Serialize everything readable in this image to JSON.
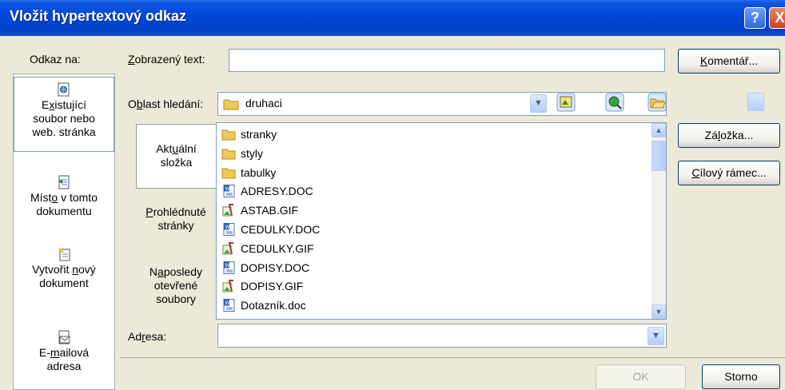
{
  "window": {
    "title": "Vložit hypertextový odkaz",
    "help_label": "?",
    "close_label": "X"
  },
  "link_to": {
    "label": "Odkaz na:",
    "items": [
      {
        "line1_pre": "E",
        "line1_key": "x",
        "line1_post": "istující",
        "line2": "soubor nebo",
        "line3": "web. stránka",
        "icon": "existing-file-icon",
        "selected": true
      },
      {
        "line1_pre": "Míst",
        "line1_key": "o",
        "line1_post": " v tomto",
        "line2": "dokumentu",
        "line3": "",
        "icon": "place-in-document-icon",
        "selected": false
      },
      {
        "line1_pre": "Vytvořit ",
        "line1_key": "n",
        "line1_post": "ový",
        "line2": "dokument",
        "line3": "",
        "icon": "new-document-icon",
        "selected": false
      },
      {
        "line1_pre": "E-",
        "line1_key": "m",
        "line1_post": "ailová",
        "line2": "adresa",
        "line3": "",
        "icon": "email-address-icon",
        "selected": false
      }
    ]
  },
  "display_text": {
    "label_key": "Z",
    "label_rest": "obrazený text:",
    "value": ""
  },
  "screentip_button": {
    "key": "K",
    "rest": "omentář..."
  },
  "look_in": {
    "label_pre": "O",
    "label_key": "b",
    "label_rest": "last hledání:",
    "value": "druhaci"
  },
  "folder_tabs": [
    {
      "line1_pre": "Akt",
      "line1_key": "u",
      "line1_post": "ální",
      "line2": "složka",
      "line3": "",
      "selected": true
    },
    {
      "line1_pre": "",
      "line1_key": "P",
      "line1_post": "rohlédnuté",
      "line2": "stránky",
      "line3": "",
      "selected": false
    },
    {
      "line1_pre": "N",
      "line1_key": "a",
      "line1_post": "posledy",
      "line2": "otevřené",
      "line3": "soubory",
      "selected": false
    }
  ],
  "files": [
    {
      "name": "stranky",
      "type": "folder"
    },
    {
      "name": "styly",
      "type": "folder"
    },
    {
      "name": "tabulky",
      "type": "folder"
    },
    {
      "name": "ADRESY.DOC",
      "type": "doc"
    },
    {
      "name": "ASTAB.GIF",
      "type": "gif"
    },
    {
      "name": "CEDULKY.DOC",
      "type": "doc"
    },
    {
      "name": "CEDULKY.GIF",
      "type": "gif"
    },
    {
      "name": "DOPISY.DOC",
      "type": "doc"
    },
    {
      "name": "DOPISY.GIF",
      "type": "gif"
    },
    {
      "name": "Dotazník.doc",
      "type": "doc"
    }
  ],
  "bookmark_button": {
    "pre": "Zá",
    "key": "l",
    "rest": "ožka..."
  },
  "target_frame_button": {
    "key": "C",
    "rest": "ílový rámec..."
  },
  "address": {
    "label_pre": "Ad",
    "label_key": "r",
    "label_rest": "esa:",
    "value": ""
  },
  "ok_label": "OK",
  "cancel_label": "Storno",
  "colors": {
    "titlebar": "#0345D6",
    "dialog_bg": "#ECE9D8",
    "folder": "#F0C85A"
  }
}
